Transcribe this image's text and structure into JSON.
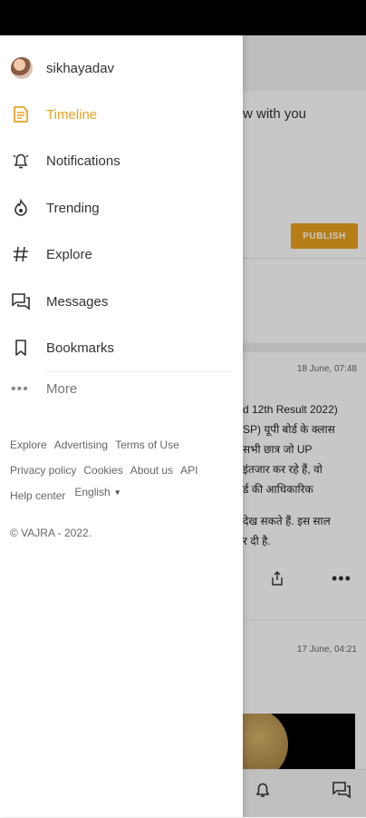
{
  "background": {
    "compose_text": "w with you",
    "publish_label": "PUBLISH",
    "post1": {
      "time": "18 June, 07:48",
      "lines": [
        "d 12th Result 2022)",
        "SP) यूपी बोर्ड के क्लास",
        "सभी छात्र जो UP",
        "इंतजार कर रहे हैं, वो",
        "र्ड की आधिकारिक",
        "",
        "देख सकते हैं. इस साल",
        "र दी है."
      ],
      "more": "•••"
    },
    "post2": {
      "time": "17 June, 04:21"
    }
  },
  "drawer": {
    "profile": {
      "username": "sikhayadav"
    },
    "nav": [
      {
        "label": "Timeline",
        "icon": "timeline-icon",
        "active": true
      },
      {
        "label": "Notifications",
        "icon": "bell-icon",
        "active": false
      },
      {
        "label": "Trending",
        "icon": "flame-icon",
        "active": false
      },
      {
        "label": "Explore",
        "icon": "hashtag-icon",
        "active": false
      },
      {
        "label": "Messages",
        "icon": "messages-icon",
        "active": false
      },
      {
        "label": "Bookmarks",
        "icon": "bookmark-icon",
        "active": false
      }
    ],
    "more": {
      "label": "More",
      "dots": "•••"
    },
    "footer": {
      "links_row1": [
        "Explore",
        "Advertising",
        "Terms of Use"
      ],
      "links_row2": [
        "Privacy policy",
        "Cookies",
        "About us",
        "API"
      ],
      "help": "Help center",
      "language": "English",
      "copyright": "© VAJRA - 2022."
    }
  },
  "colors": {
    "accent": "#e9a21f",
    "text": "#333333",
    "muted": "#666666"
  }
}
